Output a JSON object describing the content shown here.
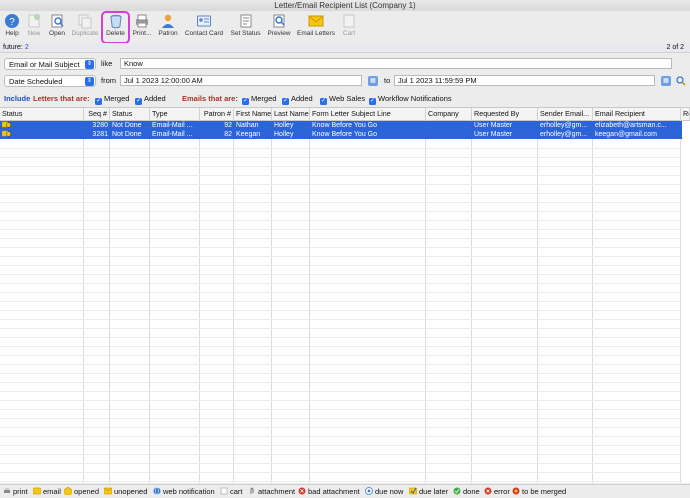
{
  "window": {
    "title": "Letter/Email Recipient List (Company 1)"
  },
  "toolbar": [
    {
      "id": "help",
      "label": "Help",
      "icon": "help-icon",
      "enabled": true
    },
    {
      "id": "new",
      "label": "New",
      "icon": "new-icon",
      "enabled": false
    },
    {
      "id": "open",
      "label": "Open",
      "icon": "open-icon",
      "enabled": true
    },
    {
      "id": "duplicate",
      "label": "Duplicate",
      "icon": "duplicate-icon",
      "enabled": false
    },
    {
      "id": "delete",
      "label": "Delete",
      "icon": "trash-icon",
      "enabled": true,
      "highlighted": true
    },
    {
      "id": "print",
      "label": "Print...",
      "icon": "printer-icon",
      "enabled": true
    },
    {
      "id": "patron",
      "label": "Patron",
      "icon": "patron-icon",
      "enabled": true
    },
    {
      "id": "contact_card",
      "label": "Contact Card",
      "icon": "contact-card-icon",
      "enabled": true
    },
    {
      "id": "set_status",
      "label": "Set Status",
      "icon": "set-status-icon",
      "enabled": true
    },
    {
      "id": "preview",
      "label": "Preview",
      "icon": "preview-icon",
      "enabled": true
    },
    {
      "id": "email_letters",
      "label": "Email Letters",
      "icon": "envelope-icon",
      "enabled": true
    },
    {
      "id": "cart",
      "label": "Cart",
      "icon": "cart-icon",
      "enabled": false
    }
  ],
  "futurebar": {
    "label": "future:",
    "value": "2",
    "page": "2 of 2"
  },
  "criteria": [
    {
      "field": "Email or Mail Subject",
      "op": "like",
      "value": "Know"
    },
    {
      "field": "Date Scheduled",
      "op": "from",
      "value": "Jul 1 2023 12:00:00 AM",
      "op2": "to",
      "value2": "Jul 1 2023 11:59:59 PM"
    }
  ],
  "include": {
    "include_label": "Include",
    "letters_label": "Letters that are:",
    "letters": [
      {
        "label": "Merged",
        "checked": true
      },
      {
        "label": "Added",
        "checked": true
      }
    ],
    "emails_label": "Emails that are:",
    "emails": [
      {
        "label": "Merged",
        "checked": true
      },
      {
        "label": "Added",
        "checked": true
      },
      {
        "label": "Web Sales",
        "checked": true
      },
      {
        "label": "Workflow Notifications",
        "checked": true
      }
    ]
  },
  "table": {
    "columns": [
      "Status",
      "Seq #",
      "Status",
      "Type",
      "Patron #",
      "First Name",
      "Last Name",
      "Form Letter Subject Line",
      "Company",
      "Requested By",
      "Sender Email...",
      "Email Recipient",
      "Re"
    ],
    "rows": [
      [
        "",
        "3280",
        "Not Done",
        "Email-Mail ...",
        "92",
        "Nathan",
        "Holley",
        "Know Before You Go",
        "",
        "User Master",
        "erholley@gm...",
        "elizabeth@artsman.c..."
      ],
      [
        "",
        "3281",
        "Not Done",
        "Email-Mail ...",
        "82",
        "Keegan",
        "Holley",
        "Know Before You Go",
        "",
        "User Master",
        "erholley@gm...",
        "keegan@gmail.com"
      ]
    ]
  },
  "legend": [
    {
      "label": "print",
      "color": "#8a8a8a"
    },
    {
      "label": "email",
      "color": "#f2c200"
    },
    {
      "label": "opened",
      "color": "#f2c200"
    },
    {
      "label": "unopened",
      "color": "#f2c200"
    },
    {
      "label": "web notification",
      "color": "#3a7bd5"
    },
    {
      "label": "cart",
      "color": "#bbbbbb"
    },
    {
      "label": "attachment",
      "color": "#777777"
    },
    {
      "label": "bad attachment",
      "color": "#d23a2a"
    },
    {
      "label": "due now",
      "color": "#3a7bd5"
    },
    {
      "label": "due later",
      "color": "#f2c200"
    },
    {
      "label": "done",
      "color": "#3cb043"
    },
    {
      "label": "error",
      "color": "#d23a2a"
    },
    {
      "label": "to be merged",
      "color": "#d23a2a"
    }
  ]
}
